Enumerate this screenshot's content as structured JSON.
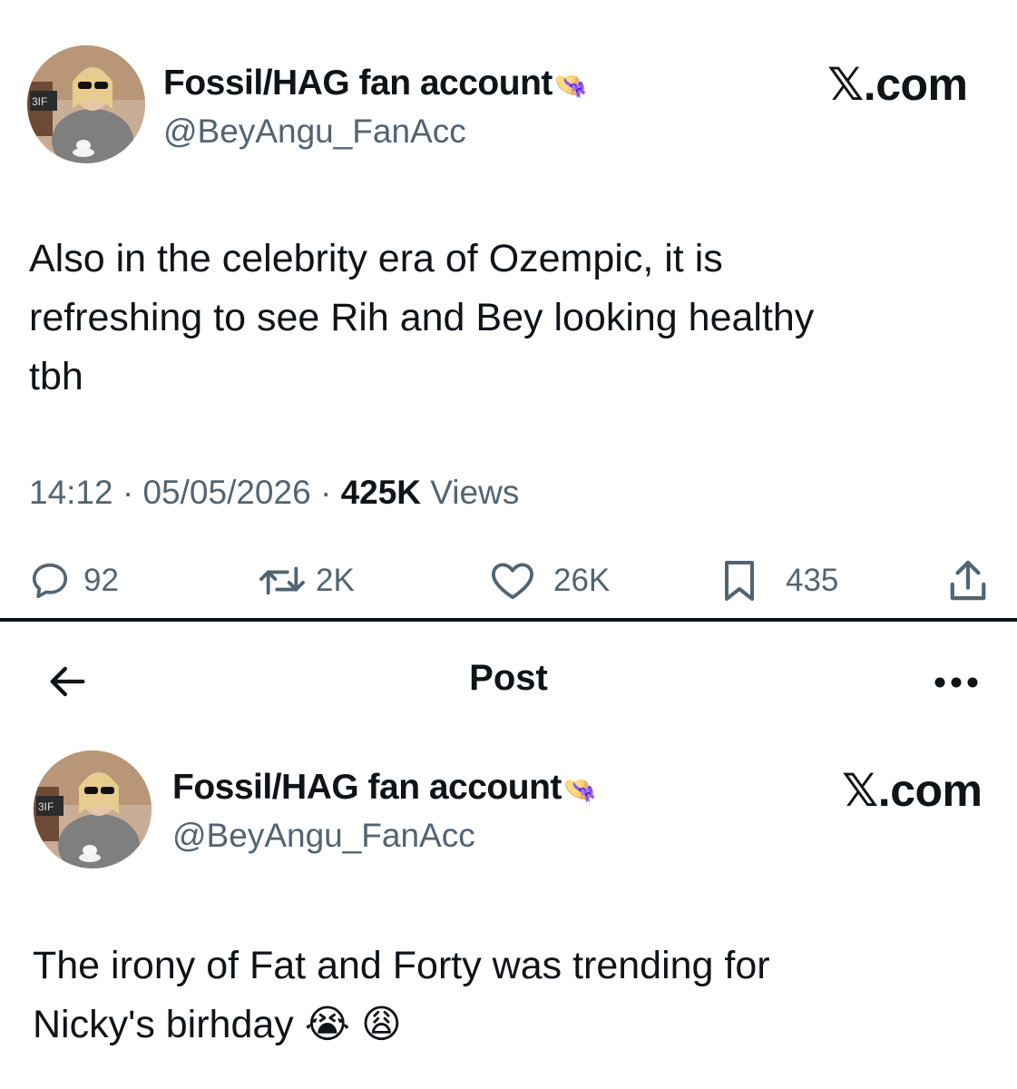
{
  "post1": {
    "display_name": "Fossil/HAG fan account",
    "name_emoji": "👒",
    "handle": "@BeyAngu_FanAcc",
    "brand": {
      "x": "𝕏",
      "suffix": ".com"
    },
    "text_lines": [
      "Also in the celebrity era of Ozempic, it is",
      "refreshing to see Rih and Bey looking healthy",
      "tbh"
    ],
    "time": "14:12",
    "date": "05/05/2026",
    "separator": "·",
    "views_count": "425K",
    "views_label": "Views",
    "actions": {
      "replies": "92",
      "reposts": "2K",
      "likes": "26K",
      "bookmarks": "435"
    }
  },
  "topbar": {
    "title": "Post"
  },
  "post2": {
    "display_name": "Fossil/HAG fan account",
    "name_emoji": "👒",
    "handle": "@BeyAngu_FanAcc",
    "brand": {
      "x": "𝕏",
      "suffix": ".com"
    },
    "text_lines": [
      "The irony of Fat and Forty was trending for",
      "Nicky's birhday"
    ],
    "emojis": [
      "😭",
      "😩"
    ]
  },
  "icons": {
    "reply": "speech-bubble-icon",
    "repost": "repost-arrows-icon",
    "like": "heart-icon",
    "bookmark": "bookmark-icon",
    "share": "share-upload-icon",
    "back": "arrow-left-icon",
    "more": "more-dots-icon"
  },
  "colors": {
    "text_primary": "#0f1419",
    "text_secondary": "#536471",
    "background": "#ffffff"
  }
}
